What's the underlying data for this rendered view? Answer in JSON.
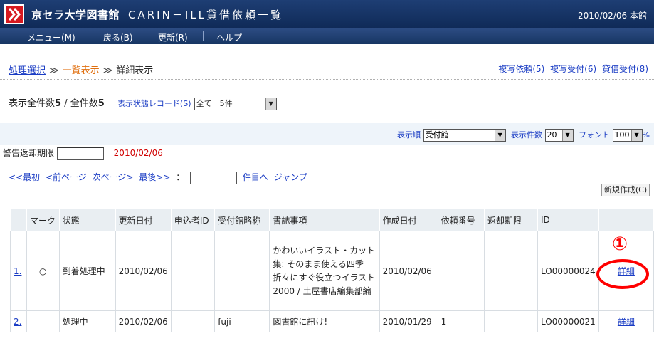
{
  "header": {
    "title": "京セラ大学図書館",
    "system": "CARIN－ILL貸借依頼一覧",
    "date_library": "2010/02/06 本館"
  },
  "menu": [
    {
      "label": "メニュー(M)"
    },
    {
      "label": "戻る(B)"
    },
    {
      "label": "更新(R)"
    },
    {
      "label": "ヘルプ"
    }
  ],
  "breadcrumb": {
    "step1": "処理選択",
    "step2": "一覧表示",
    "step3": "詳細表示",
    "arrow": "≫"
  },
  "right_links": [
    "複写依頼(5)",
    "複写受付(6)",
    "貸借受付(8)"
  ],
  "counts": {
    "display_label": "表示全件数",
    "display_value": "5",
    "slash": " / ",
    "total_label": "全件数",
    "total_value": "5",
    "state_record_label": "表示状態レコード(S)",
    "state_record_value": "全て　5件"
  },
  "display_options": {
    "order_label": "表示順",
    "order_value": "受付館",
    "count_label": "表示件数",
    "count_value": "20",
    "font_label": "フォント",
    "font_value": "100",
    "percent": "%"
  },
  "warning": {
    "label": "警告返却期限",
    "value": "",
    "date": "2010/02/06"
  },
  "pager": {
    "first": "<<最初",
    "prev": "<前ページ",
    "next": "次ページ>",
    "last": "最後>>",
    "colon": "：",
    "jump_suffix": "件目へ",
    "jump": "ジャンプ"
  },
  "new_button": "新規作成(C)",
  "table": {
    "headers": [
      "",
      "マーク",
      "状態",
      "更新日付",
      "申込者ID",
      "受付館略称",
      "書誌事項",
      "作成日付",
      "依頼番号",
      "返却期限",
      "ID",
      ""
    ],
    "rows": [
      {
        "no": "1.",
        "mark": "○",
        "status": "到着処理中",
        "updated": "2010/02/06",
        "applicant": "",
        "lib": "",
        "biblio": "かわいいイラスト・カット集: そのまま使える四季折々にすぐ役立つイラスト2000 / 土屋書店編集部編",
        "created": "2010/02/06",
        "req_no": "",
        "due": "",
        "id": "LO00000024",
        "detail": "詳細"
      },
      {
        "no": "2.",
        "mark": "",
        "status": "処理中",
        "updated": "2010/02/06",
        "applicant": "",
        "lib": "fuji",
        "biblio": "図書館に訊け!",
        "created": "2010/01/29",
        "req_no": "1",
        "due": "",
        "id": "LO00000021",
        "detail": "詳細"
      }
    ]
  },
  "annotation": {
    "number": "①"
  },
  "colors": {
    "header_bg": "#0f2a57",
    "link": "#1a3cc4",
    "warning_date": "#d00000",
    "annotation": "#ff0000"
  }
}
